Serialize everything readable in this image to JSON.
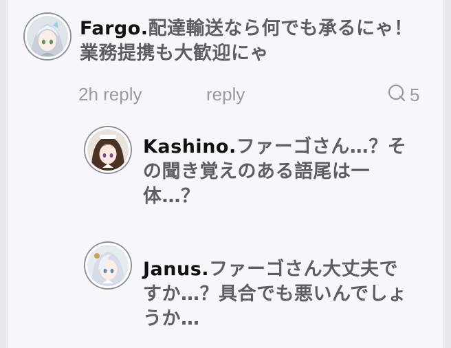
{
  "comment": {
    "author": "Fargo.",
    "text": "配達輸送なら何でも承るにゃ！業務提携も大歓迎にゃ",
    "time_label": "2h reply",
    "reply_label": "reply",
    "reply_count": "5"
  },
  "replies": [
    {
      "author": "Kashino.",
      "text": "ファーゴさん…？その聞き覚えのある語尾は一体…？"
    },
    {
      "author": "Janus.",
      "text": "ファーゴさん大丈夫ですか…？具合でも悪いんでしょうか…"
    }
  ],
  "icons": {
    "comment_count": "comment-bubble-icon"
  }
}
